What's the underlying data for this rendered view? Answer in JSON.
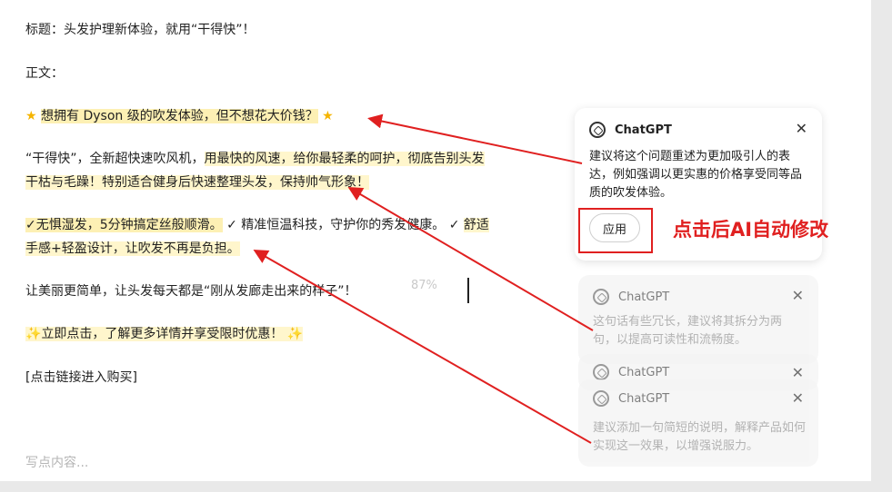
{
  "editor": {
    "title_line": "标题：头发护理新体验，就用“干得快”！",
    "body_label": "正文：",
    "star": "★",
    "line1": "想拥有 Dyson 级的吹发体验，但不想花大价钱？",
    "line2a_plain": "“干得快”，全新超快速吹风机，",
    "line2a_hl": "用最快的风速，给你最轻柔的呵护，彻底告别头发",
    "line2b": "干枯与毛躁！特别适合健身后快速整理头发，保持帅气形象！",
    "line3a_hl1": "✓无惧湿发，5分钟搞定丝般顺滑。",
    "line3a_plain": " ✓ 精准恒温科技，守护你的秀发健康。 ✓ ",
    "line3a_hl2": "舒适",
    "line3b": "手感+轻盈设计，让吹发不再是负担。",
    "line4": "让美丽更简单，让头发每天都是“刚从发廊走出来的样子”！",
    "zoom": "87%",
    "spark": "✨",
    "line5": "立即点击，了解更多详情并享受限时优惠！",
    "line6": "[点击链接进入购买]",
    "placeholder": "写点内容..."
  },
  "suggestions": [
    {
      "name": "ChatGPT",
      "text": "建议将这个问题重述为更加吸引人的表达，例如强调以更实惠的价格享受同等品质的吹发体验。",
      "apply_label": "应用"
    },
    {
      "name": "ChatGPT",
      "text": "这句话有些冗长，建议将其拆分为两句，以提高可读性和流畅度。"
    },
    {
      "name": "ChatGPT",
      "text": ""
    },
    {
      "name": "ChatGPT",
      "text": "建议添加一句简短的说明，解释产品如何实现这一效果，以增强说服力。"
    }
  ],
  "close_glyph": "✕",
  "annotation": "点击后AI自动修改",
  "colors": {
    "highlight": "#fdf0b4",
    "annotation_red": "#e02020"
  }
}
